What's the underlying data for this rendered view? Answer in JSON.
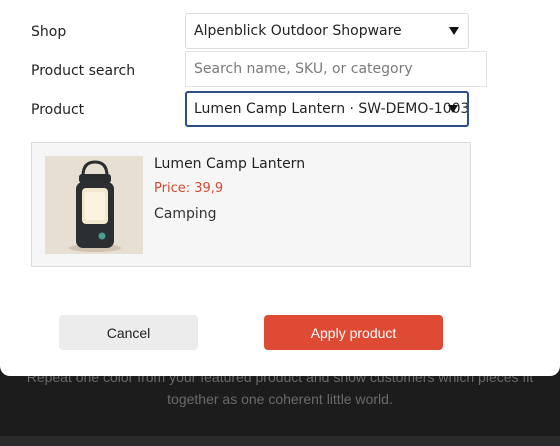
{
  "backdrop": {
    "line1": "Repeat one color from your featured product and show customers which pieces fit",
    "line2": "together as one coherent little world."
  },
  "form": {
    "shop_label": "Shop",
    "shop_value": "Alpenblick Outdoor Shopware",
    "search_label": "Product search",
    "search_placeholder": "Search name, SKU, or category",
    "search_value": "",
    "product_label": "Product",
    "product_value": "Lumen Camp Lantern · SW-DEMO-1003"
  },
  "preview": {
    "name": "Lumen Camp Lantern",
    "price": "Price: 39,9",
    "category": "Camping",
    "image_icon": "lantern-product-image"
  },
  "actions": {
    "cancel_label": "Cancel",
    "apply_label": "Apply product"
  },
  "colors": {
    "accent": "#df4a35",
    "focus_border": "#2b4d8c",
    "price": "#d24a33"
  }
}
